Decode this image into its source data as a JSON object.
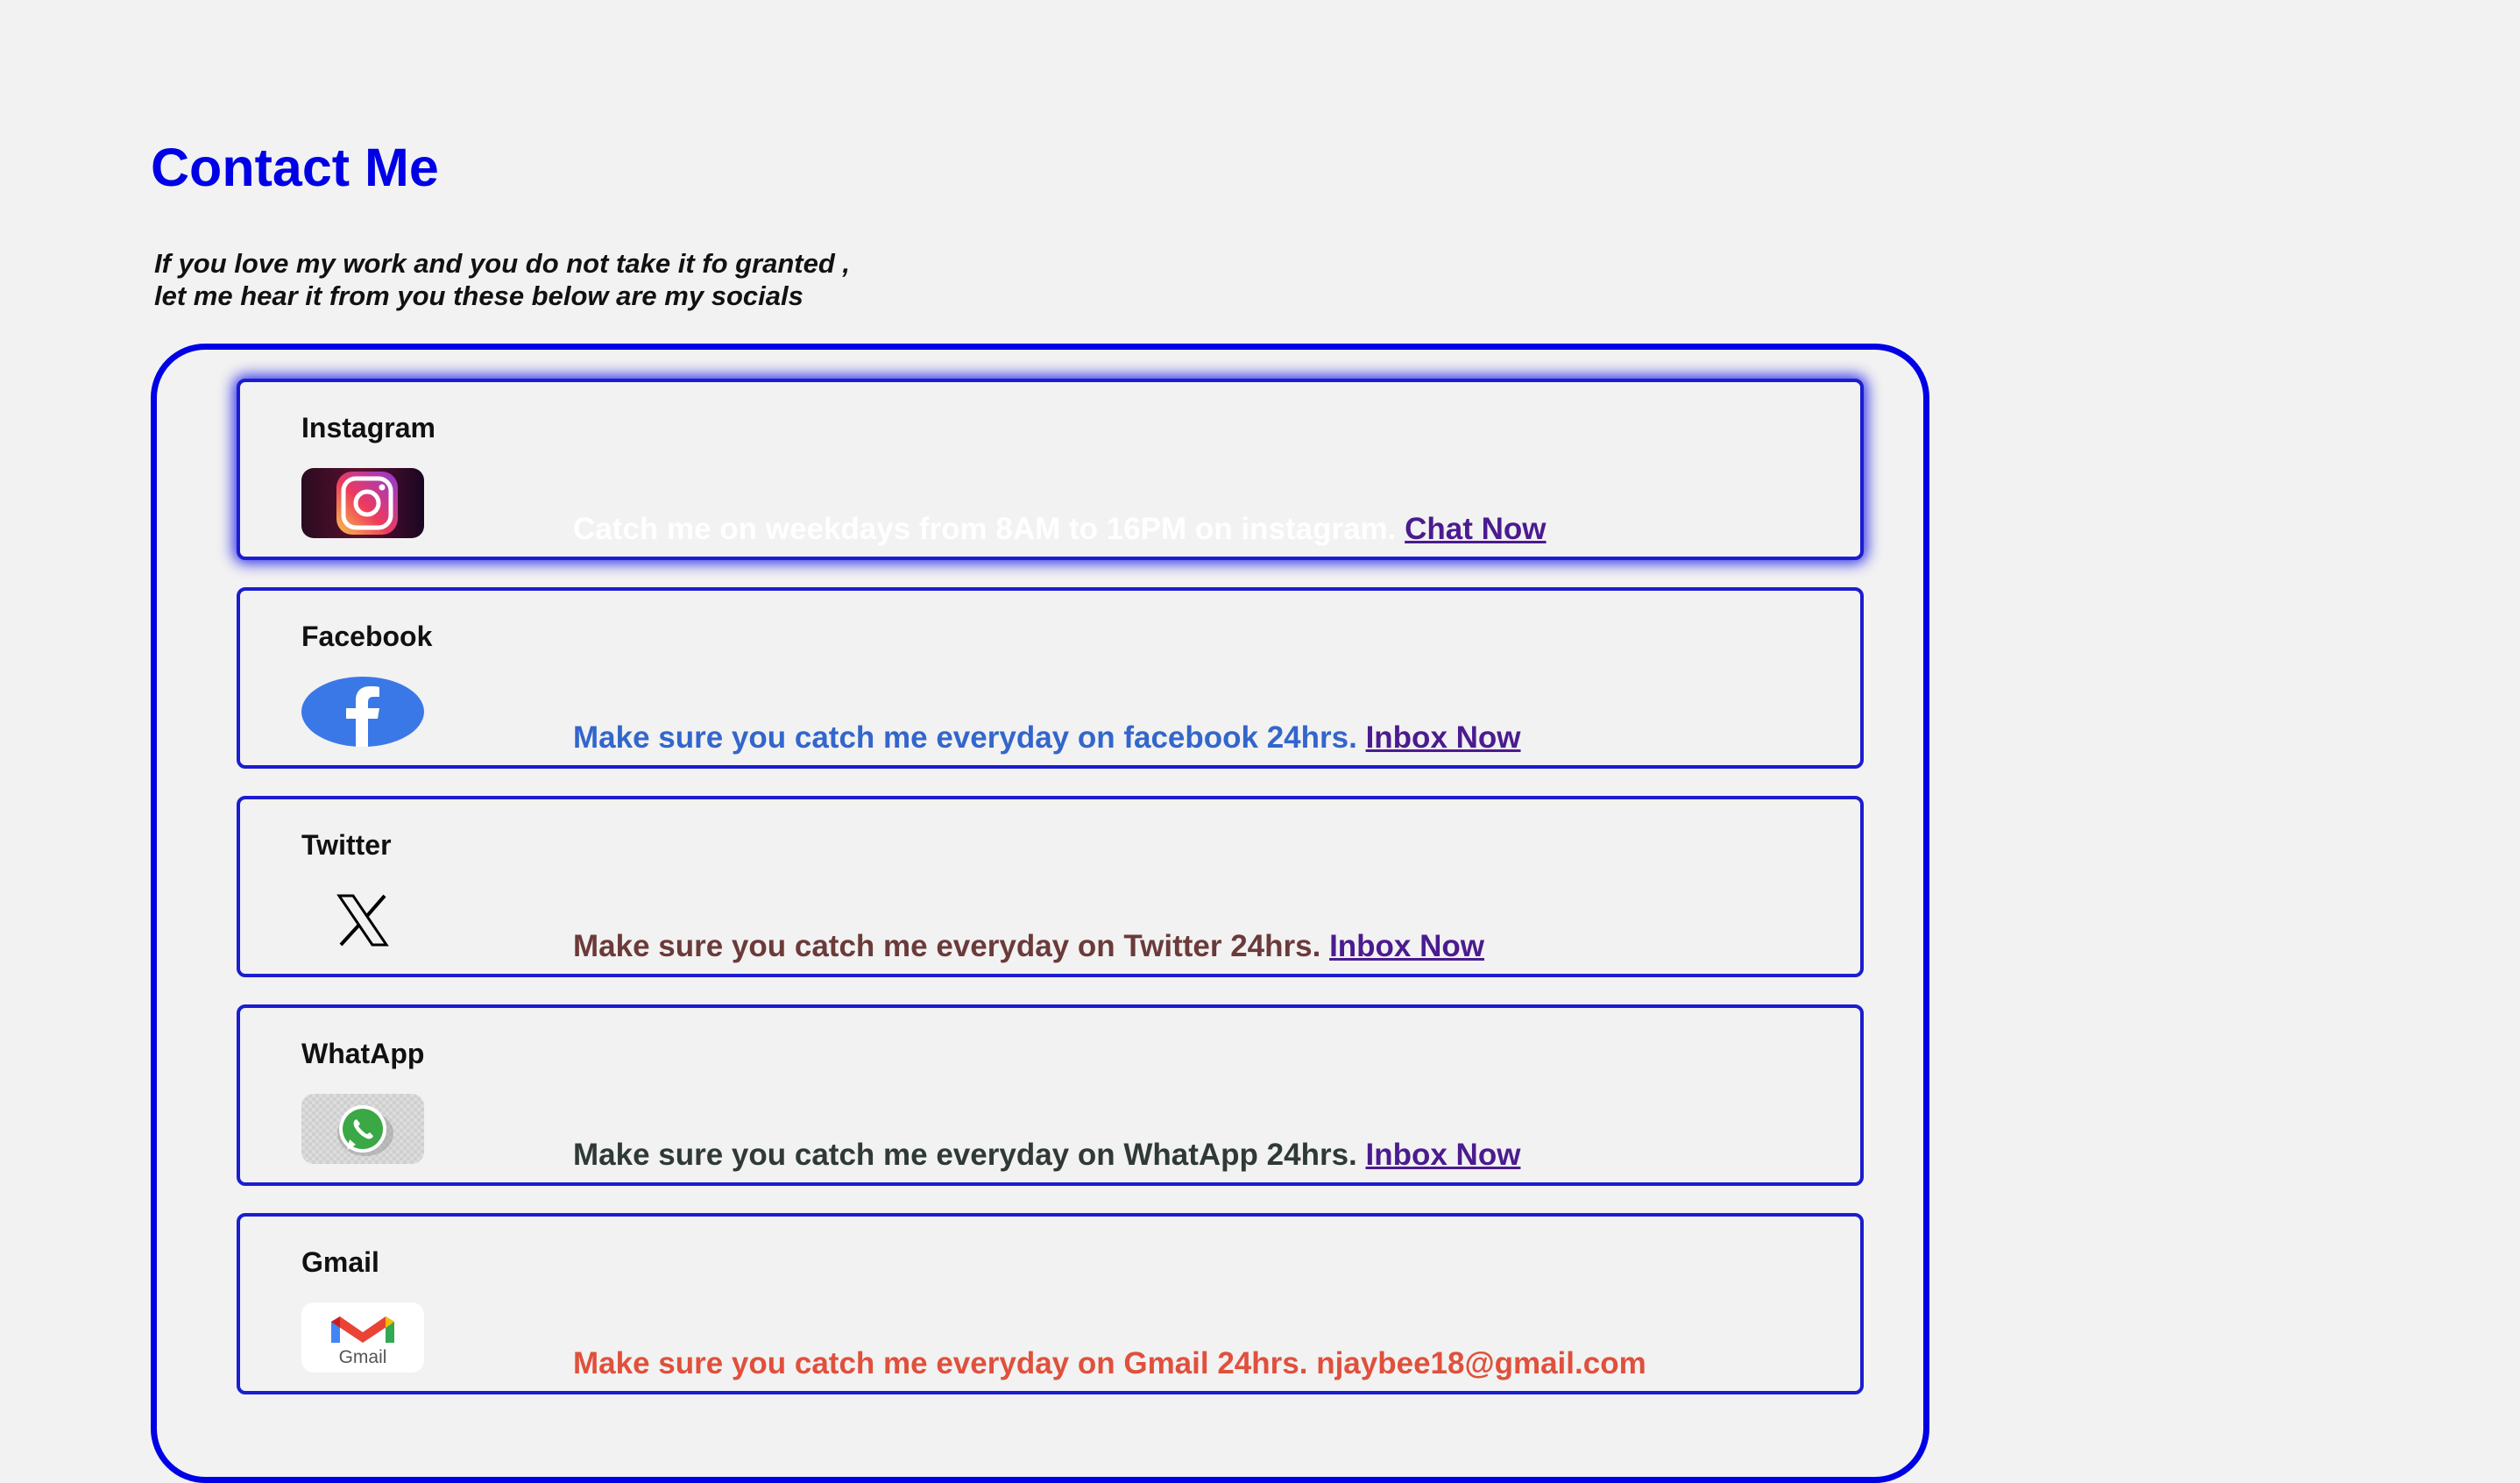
{
  "page": {
    "title": "Contact Me",
    "intro_line1": "If you love my work and you do not take it fo granted ,",
    "intro_line2": "let me hear it from you these below are my socials"
  },
  "colors": {
    "accent": "#0000e6",
    "instagram_text": "#ffffff",
    "facebook_text": "#3366cc",
    "twitter_text": "#6b3a3a",
    "whatsapp_text": "#2f3a35",
    "gmail_text": "#e0503c",
    "link": "#4b1b8f"
  },
  "socials": [
    {
      "name": "Instagram",
      "icon": "instagram-icon",
      "message": "Catch me on weekdays from 8AM to 16PM on instagram.",
      "link_label": "Chat Now"
    },
    {
      "name": "Facebook",
      "icon": "facebook-icon",
      "message": "Make sure you catch me everyday on facebook 24hrs.",
      "link_label": "Inbox Now"
    },
    {
      "name": "Twitter",
      "icon": "x-icon",
      "message": "Make sure you catch me everyday on Twitter 24hrs.",
      "link_label": "Inbox Now"
    },
    {
      "name": "WhatApp",
      "icon": "whatsapp-icon",
      "message": "Make sure you catch me everyday on WhatApp 24hrs.",
      "link_label": "Inbox Now"
    },
    {
      "name": "Gmail",
      "icon": "gmail-icon",
      "message": "Make sure you catch me everyday on Gmail 24hrs.",
      "email": "njaybee18@gmail.com",
      "icon_caption": "Gmail"
    }
  ]
}
